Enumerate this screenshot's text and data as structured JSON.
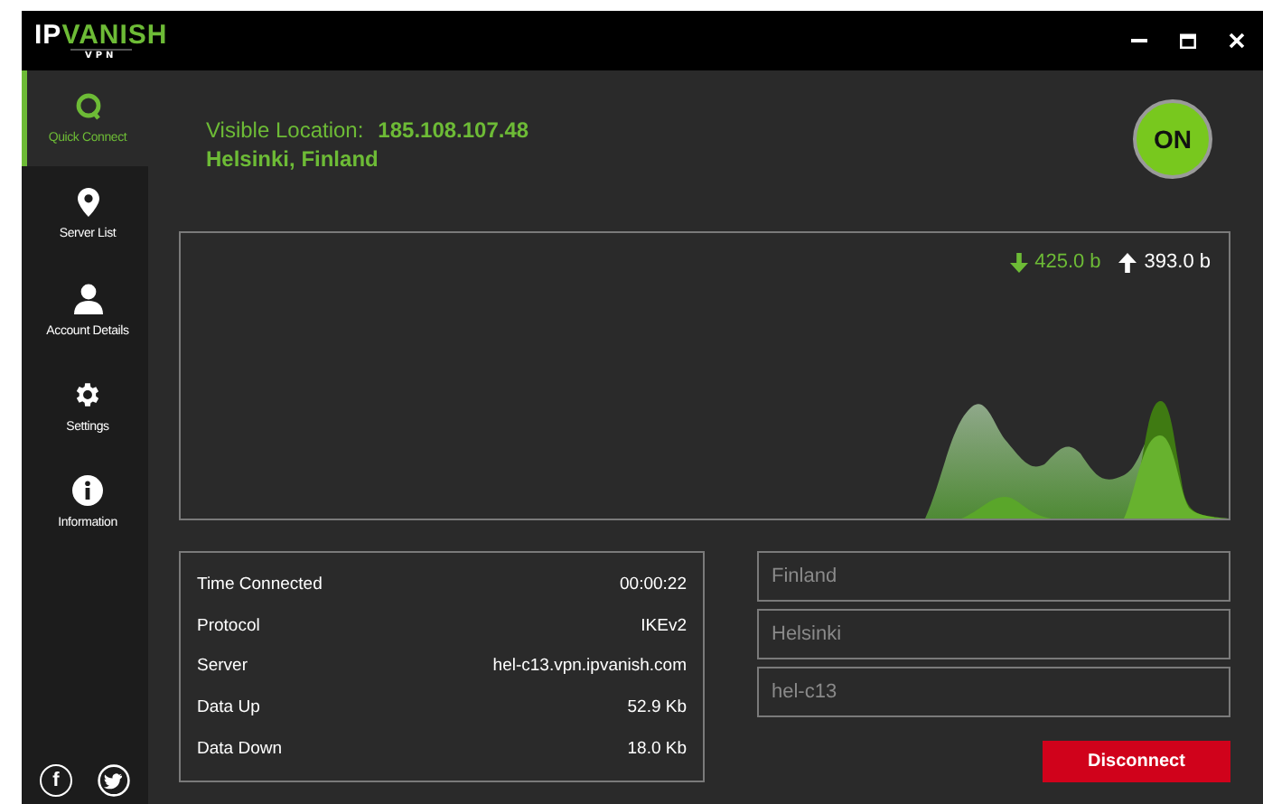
{
  "window": {
    "logo": {
      "first": "IP",
      "second": "VANISH",
      "tagline": "VPN"
    }
  },
  "sidebar": {
    "items": [
      {
        "kind": "quick",
        "label": "Quick Connect",
        "selected": true
      },
      {
        "kind": "pin",
        "label": "Server List",
        "selected": false
      },
      {
        "kind": "person",
        "label": "Account Details",
        "selected": false
      },
      {
        "kind": "gear",
        "label": "Settings",
        "selected": false
      },
      {
        "kind": "info",
        "label": "Information",
        "selected": false
      }
    ],
    "social": [
      {
        "kind": "facebook",
        "glyph": "f"
      },
      {
        "kind": "twitter"
      }
    ]
  },
  "location": {
    "label": "Visible Location:",
    "ip": "185.108.107.48",
    "place": "Helsinki, Finland"
  },
  "power": {
    "label": "ON",
    "on": true
  },
  "graph": {
    "down": "425.0 b",
    "up": "393.0 b"
  },
  "stats": [
    {
      "label": "Time Connected",
      "value": "00:00:22"
    },
    {
      "label": "Protocol",
      "value": "IKEv2"
    },
    {
      "label": "Server",
      "value": "hel-c13.vpn.ipvanish.com"
    },
    {
      "label": "Data Up",
      "value": "52.9 Kb"
    },
    {
      "label": "Data Down",
      "value": "18.0 Kb"
    }
  ],
  "fields": [
    {
      "placeholder": "Finland"
    },
    {
      "placeholder": "Helsinki"
    },
    {
      "placeholder": "hel-c13"
    }
  ],
  "disconnect": {
    "label": "Disconnect"
  }
}
